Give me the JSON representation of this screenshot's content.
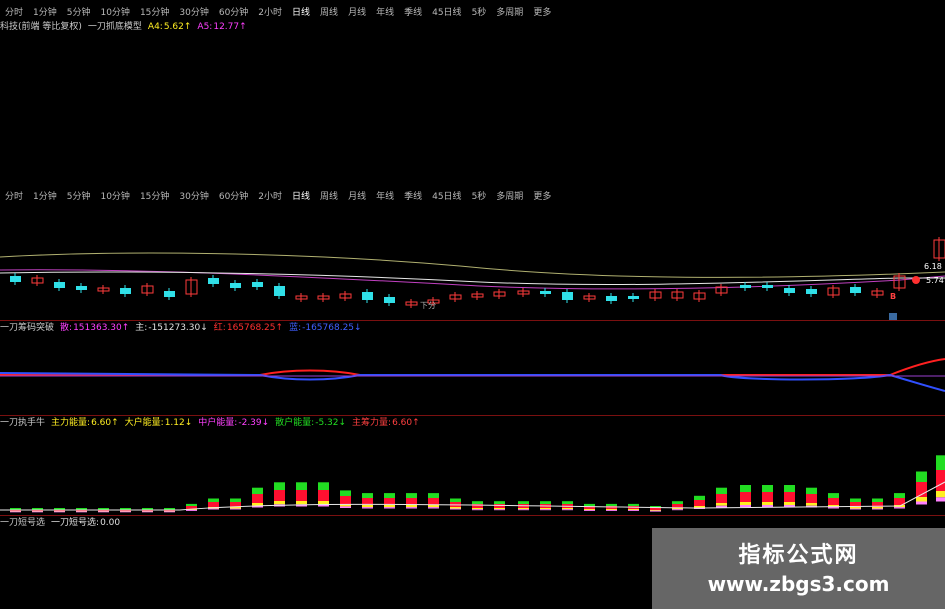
{
  "tabs": {
    "period_tabs": [
      "分时",
      "1分钟",
      "5分钟",
      "10分钟",
      "15分钟",
      "30分钟",
      "60分钟",
      "2小时",
      "日线",
      "周线",
      "月线",
      "年线",
      "季线",
      "45日线",
      "5秒",
      "多周期",
      "更多"
    ],
    "second_tabs": [
      "分时",
      "1分钟",
      "5分钟",
      "10分钟",
      "15分钟",
      "30分钟",
      "60分钟",
      "2小时",
      "日线",
      "周线",
      "月线",
      "年线",
      "季线",
      "45日线",
      "5秒",
      "多周期",
      "更多"
    ]
  },
  "main_status": {
    "stock": "科技(前端 等比复权)",
    "indicator": "一刀抓底模型",
    "a4_label": "A4:",
    "a4_value": "5.62↑",
    "a5_label": "A5:",
    "a5_value": "12.77↑"
  },
  "main_chart": {
    "price_label_1": "6.18",
    "price_label_2": "5.74",
    "signal_b": "B",
    "small_text": "下分"
  },
  "panel2_status": {
    "name": "一刀筹码突破",
    "v1_label": "散:",
    "v1_value": "151363.30↑",
    "v2_label": "主:",
    "v2_value": "-151273.30↓",
    "v3_label": "红:",
    "v3_value": "165768.25↑",
    "v4_label": "蓝:",
    "v4_value": "-165768.25↓"
  },
  "panel3_status": {
    "name": "一刀执手牛",
    "v1_label": "主力能量:",
    "v1_value": "6.60↑",
    "v2_label": "大户能量:",
    "v2_value": "1.12↓",
    "v3_label": "中户能量:",
    "v3_value": "-2.39↓",
    "v4_label": "散户能量:",
    "v4_value": "-5.32↓",
    "v5_label": "主筹力量:",
    "v5_value": "6.60↑"
  },
  "panel4_status": {
    "name": "一刀短号选",
    "v1_label": "一刀短号选:",
    "v1_value": "0.00"
  },
  "watermark": {
    "line1": "指标公式网",
    "line2": "www.zbgs3.com"
  },
  "colors": {
    "background": "#000000",
    "up": "#ff3b3b",
    "down": "#30e0e8",
    "ma_white": "#e8e8e8",
    "ma_purple": "#c040c0",
    "ma_olive": "#b0b070",
    "red_line": "#ff2020",
    "blue_line": "#3050ff",
    "bar_green": "#22dd22",
    "bar_red": "#ff1030",
    "bar_yellow": "#ffee22",
    "bar_pink": "#ff80ff"
  }
}
